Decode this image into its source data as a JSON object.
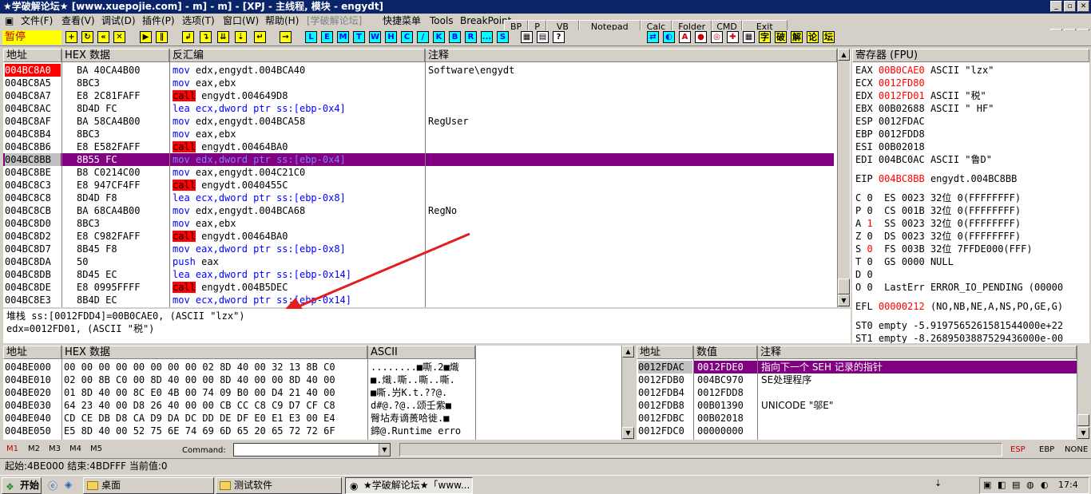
{
  "window": {
    "title": "★学破解论坛★ [www.xuepojie.com] - m] - m] - [XPJ - 主线程, 模块 - engydt]"
  },
  "menu": {
    "file": "文件(F)",
    "view": "查看(V)",
    "debug": "调试(D)",
    "plugins": "插件(P)",
    "options": "选项(T)",
    "window": "窗口(W)",
    "help": "帮助(H)",
    "forum": "[学破解论坛]",
    "shortcut": "快捷菜单",
    "tools": "Tools",
    "breakpoint": "BreakPoint"
  },
  "plugin_buttons": [
    "BP",
    "P",
    "VB",
    "Notepad",
    "Calc",
    "Folder",
    "CMD",
    "Exit"
  ],
  "toolbar": {
    "status": "暂停",
    "letters": [
      "L",
      "E",
      "M",
      "T",
      "W",
      "H",
      "C",
      "/",
      "K",
      "B",
      "R",
      "...",
      "S"
    ],
    "cn_buttons": [
      "字",
      "破",
      "解",
      "论",
      "坛"
    ]
  },
  "disasm": {
    "headers": {
      "addr": "地址",
      "hex": "HEX 数据",
      "dis": "反汇编",
      "comment": "注释"
    },
    "rows": [
      {
        "addr": "004BC8A0",
        "hex": "BA 40CA4B00",
        "op": "mov",
        "args": "edx,engydt.004BCA40",
        "comment": "Software\\engydt"
      },
      {
        "addr": "004BC8A5",
        "hex": "8BC3",
        "op": "mov",
        "args": "eax,ebx",
        "comment": ""
      },
      {
        "addr": "004BC8A7",
        "hex": "E8 2C81FAFF",
        "op": "call",
        "args": "engydt.004649D8",
        "comment": ""
      },
      {
        "addr": "004BC8AC",
        "hex": "8D4D FC",
        "op": "lea",
        "args": "ecx,dword ptr ss:[ebp-0x4]",
        "comment": ""
      },
      {
        "addr": "004BC8AF",
        "hex": "BA 58CA4B00",
        "op": "mov",
        "args": "edx,engydt.004BCA58",
        "comment": "RegUser"
      },
      {
        "addr": "004BC8B4",
        "hex": "8BC3",
        "op": "mov",
        "args": "eax,ebx",
        "comment": ""
      },
      {
        "addr": "004BC8B6",
        "hex": "E8 E582FAFF",
        "op": "call",
        "args": "engydt.00464BA0",
        "comment": ""
      },
      {
        "addr": "004BC8BB",
        "hex": "8B55 FC",
        "op": "mov",
        "args": "edx,dword ptr ss:[ebp-0x4]",
        "comment": ""
      },
      {
        "addr": "004BC8BE",
        "hex": "B8 C0214C00",
        "op": "mov",
        "args": "eax,engydt.004C21C0",
        "comment": ""
      },
      {
        "addr": "004BC8C3",
        "hex": "E8 947CF4FF",
        "op": "call",
        "args": "engydt.0040455C",
        "comment": ""
      },
      {
        "addr": "004BC8C8",
        "hex": "8D4D F8",
        "op": "lea",
        "args": "ecx,dword ptr ss:[ebp-0x8]",
        "comment": ""
      },
      {
        "addr": "004BC8CB",
        "hex": "BA 68CA4B00",
        "op": "mov",
        "args": "edx,engydt.004BCA68",
        "comment": "RegNo"
      },
      {
        "addr": "004BC8D0",
        "hex": "8BC3",
        "op": "mov",
        "args": "eax,ebx",
        "comment": ""
      },
      {
        "addr": "004BC8D2",
        "hex": "E8 C982FAFF",
        "op": "call",
        "args": "engydt.00464BA0",
        "comment": ""
      },
      {
        "addr": "004BC8D7",
        "hex": "8B45 F8",
        "op": "mov",
        "args": "eax,dword ptr ss:[ebp-0x8]",
        "comment": ""
      },
      {
        "addr": "004BC8DA",
        "hex": "50",
        "op": "push",
        "args": "eax",
        "comment": ""
      },
      {
        "addr": "004BC8DB",
        "hex": "8D45 EC",
        "op": "lea",
        "args": "eax,dword ptr ss:[ebp-0x14]",
        "comment": ""
      },
      {
        "addr": "004BC8DE",
        "hex": "E8 0995FFFF",
        "op": "call",
        "args": "engydt.004B5DEC",
        "comment": ""
      },
      {
        "addr": "004BC8E3",
        "hex": "8B4D EC",
        "op": "mov",
        "args": "ecx,dword ptr ss:[ebp-0x14]",
        "comment": ""
      }
    ]
  },
  "info": {
    "line1": "堆栈 ss:[0012FDD4]=00B0CAE0, (ASCII \"lzx\")",
    "line2": "edx=0012FD01, (ASCII \"税\")"
  },
  "registers": {
    "header": "寄存器 (FPU)",
    "lines": [
      {
        "name": "EAX",
        "val": "00B0CAE0",
        "desc": "ASCII \"lzx\"",
        "red": true
      },
      {
        "name": "ECX",
        "val": "0012FD80",
        "desc": "",
        "red": true
      },
      {
        "name": "EDX",
        "val": "0012FD01",
        "desc": "ASCII \"税\"",
        "red": true
      },
      {
        "name": "EBX",
        "val": "00B02688",
        "desc": "ASCII \" HF\"",
        "red": false
      },
      {
        "name": "ESP",
        "val": "0012FDAC",
        "desc": "",
        "red": false
      },
      {
        "name": "EBP",
        "val": "0012FDD8",
        "desc": "",
        "red": false
      },
      {
        "name": "ESI",
        "val": "00B02018",
        "desc": "",
        "red": false
      },
      {
        "name": "EDI",
        "val": "004BC0AC",
        "desc": "ASCII \"鲁D\"",
        "red": false
      }
    ],
    "eip": {
      "name": "EIP",
      "val": "004BC8BB",
      "desc": "engydt.004BC8BB"
    },
    "flags": [
      {
        "f": "C",
        "v": "0",
        "seg": "ES 0023 32位 0(FFFFFFFF)",
        "red": false
      },
      {
        "f": "P",
        "v": "0",
        "seg": "CS 001B 32位 0(FFFFFFFF)",
        "red": false
      },
      {
        "f": "A",
        "v": "1",
        "seg": "SS 0023 32位 0(FFFFFFFF)",
        "red": true
      },
      {
        "f": "Z",
        "v": "0",
        "seg": "DS 0023 32位 0(FFFFFFFF)",
        "red": false
      },
      {
        "f": "S",
        "v": "0",
        "seg": "FS 003B 32位 7FFDE000(FFF)",
        "red": true
      },
      {
        "f": "T",
        "v": "0",
        "seg": "GS 0000 NULL",
        "red": false
      },
      {
        "f": "D",
        "v": "0",
        "seg": "",
        "red": false
      },
      {
        "f": "O",
        "v": "0",
        "seg": "LastErr ERROR_IO_PENDING (00000",
        "red": false
      }
    ],
    "efl": {
      "name": "EFL",
      "val": "00000212",
      "desc": "(NO,NB,NE,A,NS,PO,GE,G)"
    },
    "st": [
      "ST0 empty -5.9197565261581544000e+22",
      "ST1 empty -8.2689503887529436000e-00"
    ]
  },
  "dump": {
    "headers": {
      "addr": "地址",
      "hex": "HEX 数据",
      "ascii": "ASCII"
    },
    "rows": [
      {
        "addr": "004BE000",
        "hex": "00 00 00 00 00 00 00 00 02 8D 40 00 32 13 8B C0",
        "ascii": "........■嘶.2■熾"
      },
      {
        "addr": "004BE010",
        "hex": "02 00 8B C0 00 8D 40 00 00 8D 40 00 00 8D 40 00",
        "ascii": "■.熾.嘶..嘶..嘶."
      },
      {
        "addr": "004BE020",
        "hex": "01 8D 40 00 8C E0 4B 00 74 09 B0 00 D4 21 40 00",
        "ascii": "■嘶.屶K.t.??@."
      },
      {
        "addr": "004BE030",
        "hex": "64 23 40 00 D8 26 40 00 00 CB CC C8 C9 D7 CF C8",
        "ascii": "d#@.?@..颂壬紫■"
      },
      {
        "addr": "004BE040",
        "hex": "CD CE DB D8 CA D9 DA DC DD DE DF E0 E1 E3 00 E4",
        "ascii": "臀坫寿谪蒉哈徙.■"
      },
      {
        "addr": "004BE050",
        "hex": "E5 8D 40 00 52 75 6E 74 69 6D 65 20 65 72 72 6F",
        "ascii": "鍗@.Runtime erro"
      }
    ]
  },
  "stack": {
    "headers": {
      "addr": "地址",
      "val": "数值",
      "comment": "注释"
    },
    "rows": [
      {
        "addr": "0012FDAC",
        "val": "0012FDE0",
        "comment": "指向下一个 SEH 记录的指针"
      },
      {
        "addr": "0012FDB0",
        "val": "004BC970",
        "comment": "SE处理程序"
      },
      {
        "addr": "0012FDB4",
        "val": "0012FDD8",
        "comment": ""
      },
      {
        "addr": "0012FDB8",
        "val": "00B01390",
        "comment": "UNICODE \"邬E\""
      },
      {
        "addr": "0012FDBC",
        "val": "00B02018",
        "comment": ""
      },
      {
        "addr": "0012FDC0",
        "val": "00000000",
        "comment": ""
      }
    ]
  },
  "cmdbar": {
    "marks": [
      "M1",
      "M2",
      "M3",
      "M4",
      "M5"
    ],
    "command_label": "Command:",
    "command_value": "",
    "right": [
      "ESP",
      "EBP",
      "NONE"
    ]
  },
  "status": {
    "text": "起始:4BE000 结束:4BDFFF 当前值:0"
  },
  "taskbar": {
    "start": "开始",
    "tasks": [
      "桌面",
      "测试软件",
      "★学破解论坛★「www..."
    ],
    "clock": "17:4"
  },
  "colors": {
    "selection": "#800080",
    "eip_red": "#ff0000",
    "call_bg": "#ff0000",
    "mnemonic": "#0000ff",
    "title": "#0a246a"
  }
}
